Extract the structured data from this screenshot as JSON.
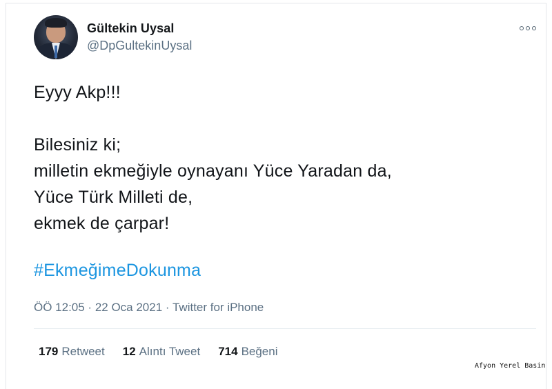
{
  "user": {
    "name": "Gültekin Uysal",
    "handle": "@DpGultekinUysal"
  },
  "tweet": {
    "lines": [
      "Eyyy Akp!!!",
      "",
      "Bilesiniz ki;",
      "milletin ekmeğiyle oynayanı Yüce Yaradan da,",
      "Yüce Türk Milleti de,",
      "ekmek de çarpar!"
    ],
    "hashtag": "#EkmeğimeDokunma",
    "timestamp": "ÖÖ 12:05 · 22 Oca 2021 · Twitter for iPhone"
  },
  "stats": {
    "retweets": {
      "count": "179",
      "label": "Retweet"
    },
    "quotes": {
      "count": "12",
      "label": "Alıntı Tweet"
    },
    "likes": {
      "count": "714",
      "label": "Beğeni"
    }
  },
  "watermark": "Afyon Yerel Basin",
  "icons": {
    "more": "more-options-icon"
  },
  "colors": {
    "hashtag": "#1b95e0",
    "secondary_text": "#5b7083",
    "primary_text": "#14171a"
  }
}
